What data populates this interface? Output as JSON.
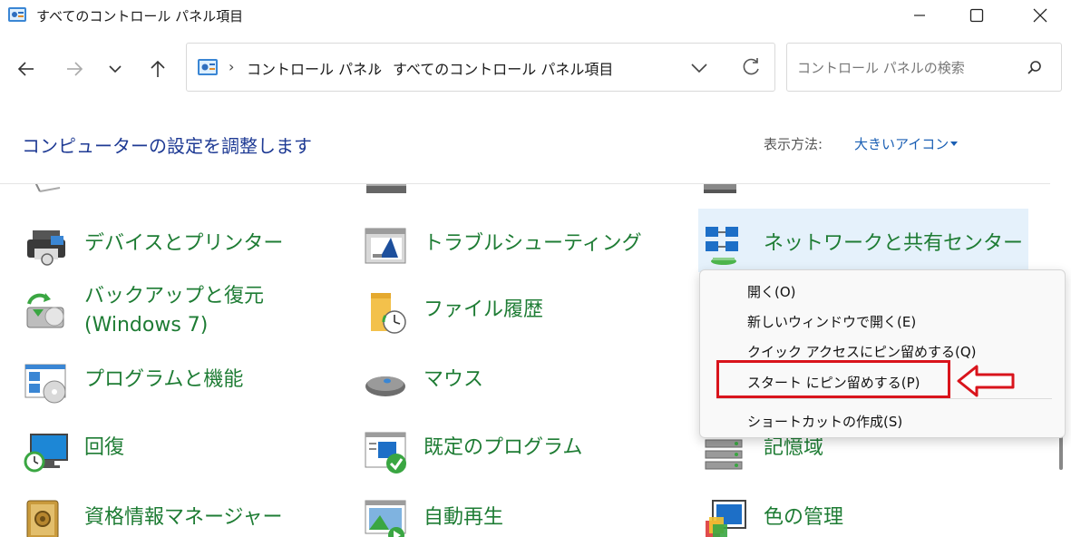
{
  "window": {
    "title": "すべてのコントロール パネル項目"
  },
  "address": {
    "crumb1": "コントロール パネル",
    "crumb2": "すべてのコントロール パネル項目",
    "sep": "›"
  },
  "search": {
    "placeholder": "コントロール パネルの検索"
  },
  "header": {
    "title": "コンピューターの設定を調整します",
    "view_label": "表示方法:",
    "view_value": "大きいアイコン"
  },
  "items": [
    {
      "label": "デバイスとプリンター",
      "icon": "printer-icon"
    },
    {
      "label": "トラブルシューティング",
      "icon": "troubleshoot-icon"
    },
    {
      "label": "ネットワークと共有センター",
      "icon": "network-icon"
    },
    {
      "label": "バックアップと復元",
      "label2": "(Windows 7)",
      "icon": "backup-icon"
    },
    {
      "label": "ファイル履歴",
      "icon": "file-history-icon"
    },
    {
      "label": "プログラムと機能",
      "icon": "programs-icon"
    },
    {
      "label": "マウス",
      "icon": "mouse-icon"
    },
    {
      "label": "回復",
      "icon": "recovery-icon"
    },
    {
      "label": "既定のプログラム",
      "icon": "default-programs-icon"
    },
    {
      "label": "記憶域",
      "icon": "storage-icon"
    },
    {
      "label": "資格情報マネージャー",
      "icon": "credential-icon"
    },
    {
      "label": "自動再生",
      "icon": "autoplay-icon"
    },
    {
      "label": "色の管理",
      "icon": "color-icon"
    }
  ],
  "context_menu": {
    "items": [
      "開く(O)",
      "新しいウィンドウで開く(E)",
      "クイック アクセスにピン留めする(Q)",
      "スタート にピン留めする(P)",
      "ショートカットの作成(S)"
    ]
  },
  "colors": {
    "link_green": "#1e7c34",
    "heading_blue": "#1e3a94",
    "highlight_red": "#d9141c",
    "hover_bg": "#e5f1fb"
  }
}
